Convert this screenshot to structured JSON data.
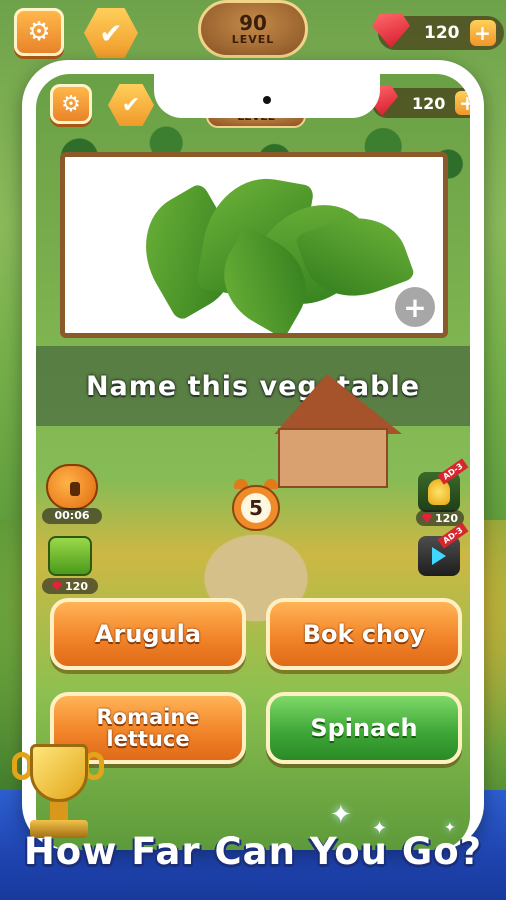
{
  "outer_top": {
    "settings_icon": "gear-icon",
    "check_icon": "check-icon",
    "level_number": "90",
    "level_label": "LEVEL",
    "gems": "120",
    "plus_label": "+"
  },
  "screen_top": {
    "settings_icon": "gear-icon",
    "check_icon": "check-icon",
    "level_label": "LEVEL",
    "gems": "120",
    "plus_label": "+"
  },
  "question": {
    "text": "Name this vegetable",
    "zoom_icon": "zoom-in-icon"
  },
  "boosters": {
    "timer_value": "00:06",
    "hint_cost": "120",
    "can_cost": "120",
    "clock_value": "5",
    "ad_label": "AD-3"
  },
  "answers": [
    {
      "label": "Arugula",
      "style": "orange"
    },
    {
      "label": "Bok choy",
      "style": "orange"
    },
    {
      "label": "Romaine lettuce",
      "style": "orange"
    },
    {
      "label": "Spinach",
      "style": "green"
    }
  ],
  "promo": {
    "tagline": "How Far Can You Go?"
  },
  "colors": {
    "answer_orange": "#f2852a",
    "answer_green": "#3fa838",
    "promo_blue": "#1f44b0",
    "gem_red": "#d3152c"
  }
}
